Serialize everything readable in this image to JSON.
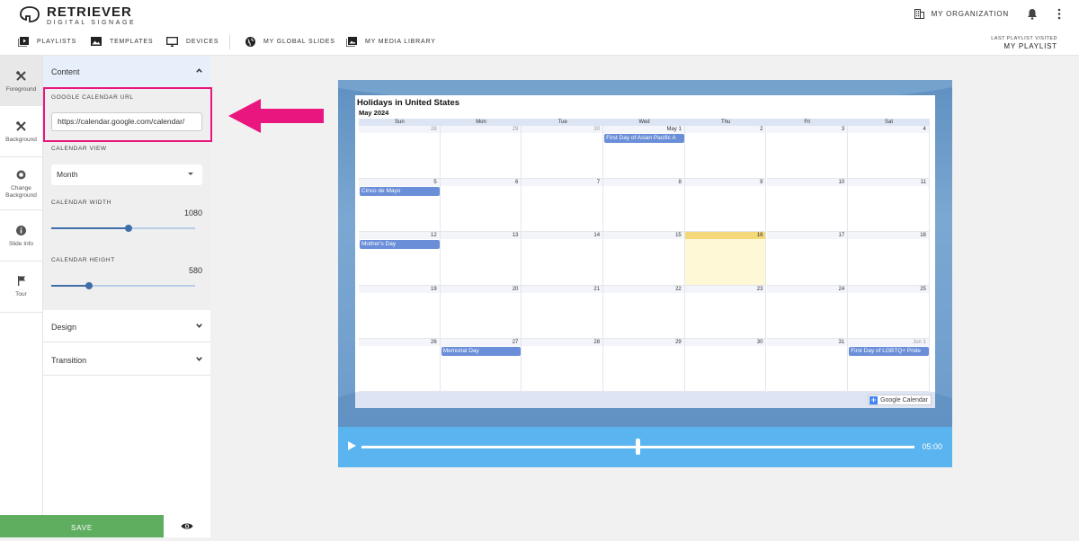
{
  "brand": {
    "name": "RETRIEVER",
    "tagline": "DIGITAL SIGNAGE"
  },
  "header": {
    "organization": "MY ORGANIZATION"
  },
  "nav": {
    "items": [
      "PLAYLISTS",
      "TEMPLATES",
      "DEVICES",
      "MY GLOBAL SLIDES",
      "MY MEDIA LIBRARY"
    ],
    "last_visited_label": "LAST PLAYLIST VISITED",
    "last_visited_value": "MY PLAYLIST"
  },
  "sidebar": {
    "items": [
      {
        "label": "Foreground",
        "icon": "tools-icon",
        "active": true
      },
      {
        "label": "Background",
        "icon": "tools-icon",
        "active": false
      },
      {
        "label": "Change Background",
        "icon": "swap-icon",
        "active": false
      },
      {
        "label": "Slide Info",
        "icon": "info-icon",
        "active": false
      },
      {
        "label": "Tour",
        "icon": "flag-icon",
        "active": false
      }
    ]
  },
  "panel": {
    "content_title": "Content",
    "url_label": "GOOGLE CALENDAR URL",
    "url_value": "https://calendar.google.com/calendar/",
    "view_label": "CALENDAR VIEW",
    "view_value": "Month",
    "width_label": "CALENDAR WIDTH",
    "width_value": "1080",
    "width_fraction": 0.54,
    "height_label": "CALENDAR HEIGHT",
    "height_value": "580",
    "height_fraction": 0.26,
    "design_title": "Design",
    "transition_title": "Transition",
    "save_label": "SAVE"
  },
  "calendar": {
    "title": "Holidays in United States",
    "month": "May 2024",
    "day_names": [
      "Sun",
      "Mon",
      "Tue",
      "Wed",
      "Thu",
      "Fri",
      "Sat"
    ],
    "weeks": [
      [
        "28",
        "29",
        "30",
        "May 1",
        "2",
        "3",
        "4"
      ],
      [
        "5",
        "6",
        "7",
        "8",
        "9",
        "10",
        "11"
      ],
      [
        "12",
        "13",
        "14",
        "15",
        "16",
        "17",
        "18"
      ],
      [
        "19",
        "20",
        "21",
        "22",
        "23",
        "24",
        "25"
      ],
      [
        "26",
        "27",
        "28",
        "29",
        "30",
        "31",
        "Jun 1"
      ]
    ],
    "muted_cells": [
      "0-0",
      "0-1",
      "0-2",
      "4-6"
    ],
    "today_cell": "2-4",
    "events": [
      {
        "week": 0,
        "day": 3,
        "label": "First Day of Asian Pacific A"
      },
      {
        "week": 1,
        "day": 0,
        "label": "Cinco de Mayo"
      },
      {
        "week": 2,
        "day": 0,
        "label": "Mother's Day"
      },
      {
        "week": 4,
        "day": 1,
        "label": "Memorial Day"
      },
      {
        "week": 4,
        "day": 6,
        "label": "First Day of LGBTQ+ Pride"
      }
    ],
    "badge": "Google Calendar"
  },
  "player": {
    "time": "05:00",
    "progress": 0.5
  },
  "colors": {
    "accent": "#3f6ea8",
    "highlight": "#e8167e",
    "save": "#5fae5f",
    "player": "#5ab4ef",
    "event": "#6a8ed8",
    "today": "#fff8d6"
  }
}
